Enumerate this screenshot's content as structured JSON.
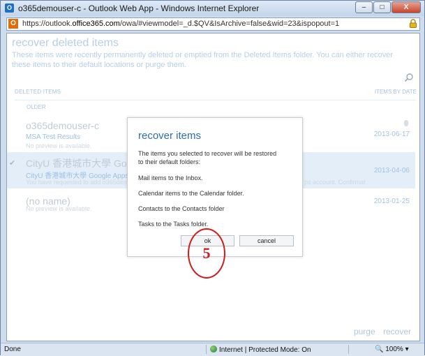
{
  "window": {
    "title": "o365demouser-c - Outlook Web App - Windows Internet Explorer",
    "minimize": "–",
    "maximize": "□",
    "close": "X"
  },
  "address": {
    "url_prefix": "https://outlook.",
    "url_domain": "office365.com",
    "url_rest": "/owa/#viewmodel=_d.$QV&IsArchive=false&wid=23&ispopout=1"
  },
  "page": {
    "title": "recover deleted items",
    "description": "These items were recently permanently deleted or emptied from the Deleted Items folder. You can either recover these items to their default locations or purge them.",
    "col_left": "DELETED ITEMS",
    "col_right": "ITEMS BY DATE",
    "group": "OLDER",
    "rows": [
      {
        "sender": "o365demouser-c",
        "subject": "MSA Test Results",
        "preview": "No preview is available.",
        "date": "2013-06-17",
        "check": ""
      },
      {
        "sender": "CityU 香港城市大學 Goo",
        "subject": "CityU 香港城市大學 Google Apps Cor",
        "preview": "You have requested to add o365demo",
        "preview_tail": "ps account. Confirmat",
        "date": "2013-04-06",
        "check": "✔"
      },
      {
        "sender": "(no name)",
        "subject": "",
        "preview": "No preview is available.",
        "date": "2013-01-25",
        "check": ""
      }
    ],
    "purge": "purge",
    "recover": "recover"
  },
  "dialog": {
    "title": "recover items",
    "line1": "The items you selected to recover will be restored",
    "line2": "to their default folders:",
    "line3": "Mail items to the Inbox.",
    "line4": "Calendar items to the Calendar folder.",
    "line5": "Contacts to the Contacts folder",
    "line6": "Tasks to the Tasks folder.",
    "ok": "ok",
    "cancel": "cancel"
  },
  "annotation": {
    "step": "5",
    "color": "#d01c1c"
  },
  "status": {
    "done": "Done",
    "zone": "Internet | Protected Mode: On",
    "zoom": "100%"
  }
}
